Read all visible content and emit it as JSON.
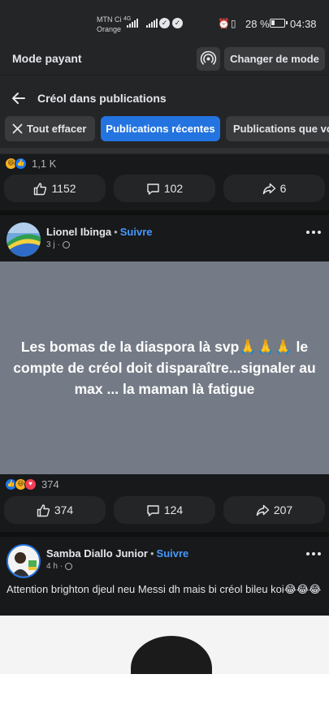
{
  "status_bar": {
    "carrier_line1": "MTN Ci",
    "carrier_line2": "Orange",
    "network_type": "4G",
    "battery": "28 %",
    "time": "04:38"
  },
  "mode_bar": {
    "title": "Mode payant",
    "change_mode_label": "Changer de mode"
  },
  "search": {
    "title": "Créol dans publications",
    "filters": [
      {
        "label": "Tout effacer",
        "active": false
      },
      {
        "label": "Publications récentes",
        "active": true
      },
      {
        "label": "Publications que vous",
        "active": false
      }
    ]
  },
  "posts": [
    {
      "reaction_count": "1,1 K",
      "likes": "1152",
      "comments": "102",
      "shares": "6"
    },
    {
      "author": "Lionel Ibinga",
      "follow_label": "Suivre",
      "time": "3 j",
      "card_text": "Les bomas de la diaspora là svp🙏🙏🙏 le compte de créol doit disparaître...signaler au max ... la maman là fatigue",
      "card_color": "#747b86",
      "reaction_count": "374",
      "likes": "374",
      "comments": "124",
      "shares": "207"
    },
    {
      "author": "Samba Diallo Junior",
      "follow_label": "Suivre",
      "time": "4 h",
      "text": "Attention brighton djeul neu Messi dh mais bi créol bileu koi😂😂😂"
    }
  ],
  "colors": {
    "accent": "#2374e1",
    "link": "#4599ff",
    "background": "#18191a",
    "surface": "#242526"
  }
}
